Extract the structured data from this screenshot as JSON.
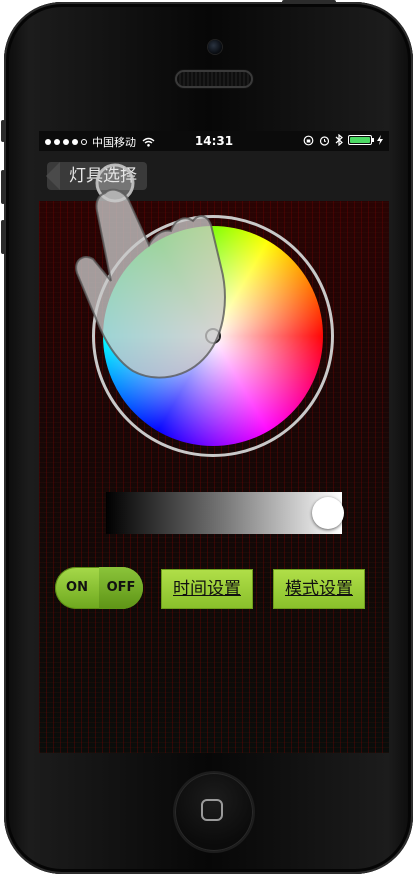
{
  "status_bar": {
    "signal_dots": 4,
    "carrier": "中国移动",
    "time": "14:31",
    "battery_level": 1.0,
    "battery_color": "#4cd964"
  },
  "nav": {
    "back_label": "灯具选择"
  },
  "color_picker": {
    "brightness_level": 1.0
  },
  "controls": {
    "toggle_on_label": "ON",
    "toggle_off_label": "OFF",
    "time_settings_label": "时间设置",
    "mode_settings_label": "模式设置"
  },
  "icons": {
    "wifi": "wifi-icon",
    "lock_rotation": "rotation-lock-icon",
    "alarm": "alarm-icon",
    "bluetooth": "bluetooth-icon",
    "charging": "charging-bolt-icon",
    "gesture": "tap-hand-icon"
  },
  "colors": {
    "button_green": "#9fd13c",
    "nav_background": "#1b1b1b"
  }
}
